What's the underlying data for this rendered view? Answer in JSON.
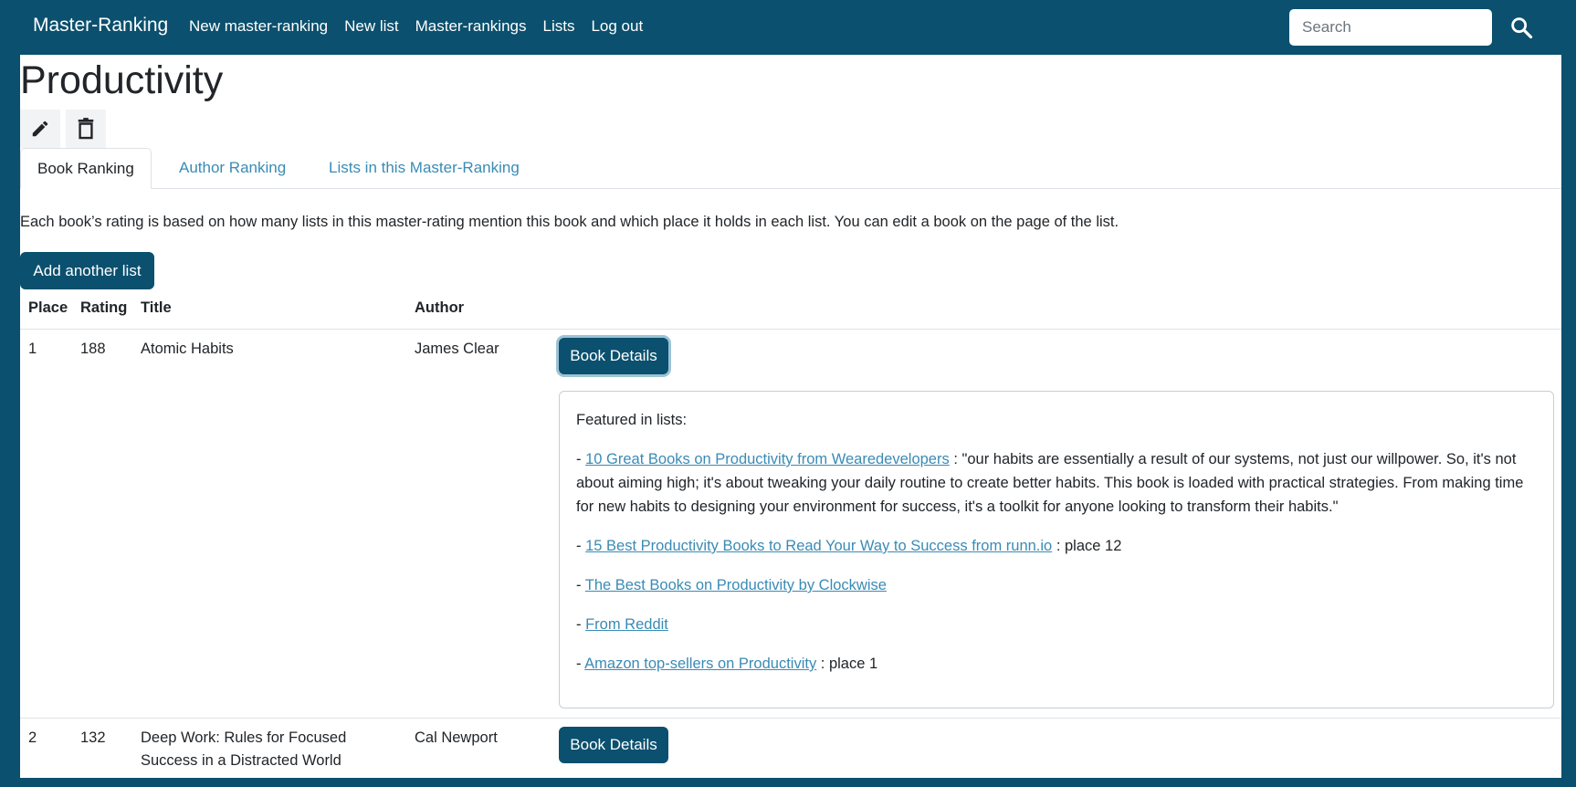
{
  "navbar": {
    "brand": "Master-Ranking",
    "links": [
      "New master-ranking",
      "New list",
      "Master-rankings",
      "Lists",
      "Log out"
    ],
    "search_placeholder": "Search"
  },
  "page": {
    "title": "Productivity",
    "tabs": [
      "Book Ranking",
      "Author Ranking",
      "Lists in this Master-Ranking"
    ],
    "active_tab": "Book Ranking",
    "intro": "Each book’s rating is based on how many lists in this master-rating mention this book and which place it holds in each list. You can edit a book on the page of the list.",
    "add_list_label": "Add another list"
  },
  "table": {
    "headers": [
      "Place",
      "Rating",
      "Title",
      "Author"
    ],
    "rows": [
      {
        "place": "1",
        "rating": "188",
        "title": "Atomic Habits",
        "author": "James Clear",
        "button": "Book Details"
      },
      {
        "place": "2",
        "rating": "132",
        "title": "Deep Work: Rules for Focused Success in a Distracted World",
        "author": "Cal Newport",
        "button": "Book Details"
      }
    ]
  },
  "details": {
    "heading": "Featured in lists:",
    "entries": [
      {
        "prefix": "- ",
        "link": "10 Great Books on Productivity from Wearedevelopers",
        "suffix": " : \"our habits are essentially a result of our systems, not just our willpower. So, it's not about aiming high; it's about tweaking your daily routine to create better habits. This book is loaded with practical strategies. From making time for new habits to designing your environment for success, it's a toolkit for anyone looking to transform their habits.\""
      },
      {
        "prefix": "- ",
        "link": "15 Best Productivity Books to Read Your Way to Success from runn.io",
        "suffix": " : place 12"
      },
      {
        "prefix": "- ",
        "link": "The Best Books on Productivity by Clockwise",
        "suffix": ""
      },
      {
        "prefix": "- ",
        "link": "From Reddit",
        "suffix": ""
      },
      {
        "prefix": "- ",
        "link": "Amazon top-sellers on Productivity",
        "suffix": " : place 1"
      }
    ]
  },
  "colors": {
    "primary": "#0b506e",
    "link": "#3a8bb5",
    "border": "#dee2e6"
  }
}
